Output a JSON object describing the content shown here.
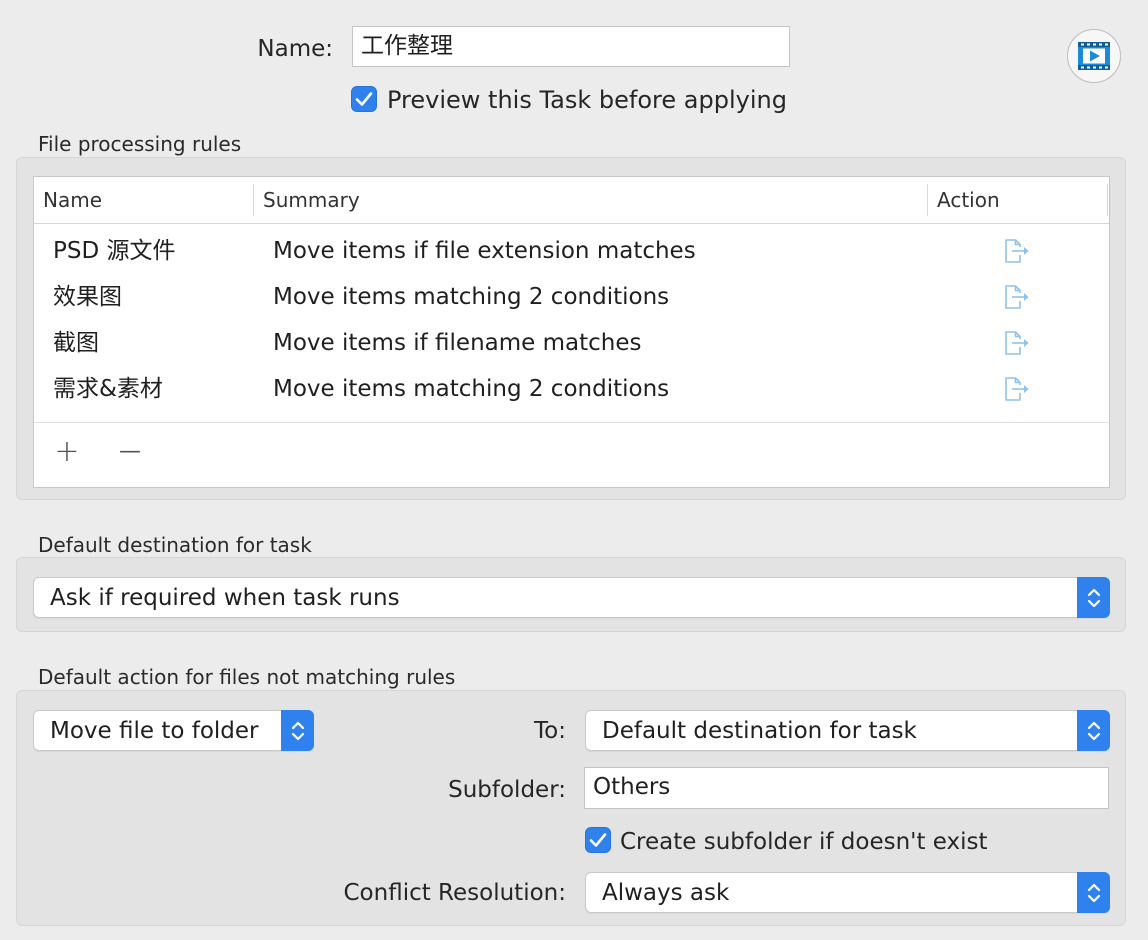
{
  "header": {
    "name_label": "Name:",
    "name_value": "工作整理",
    "preview_checkbox_label": "Preview this Task before applying",
    "preview_checked": true,
    "play_icon": "play-film-icon"
  },
  "rules": {
    "section_title": "File processing rules",
    "columns": [
      "Name",
      "Summary",
      "Action"
    ],
    "rows": [
      {
        "name": "PSD 源文件",
        "summary": "Move items if file extension matches",
        "action_icon": "move-out-icon"
      },
      {
        "name": "效果图",
        "summary": "Move items matching 2 conditions",
        "action_icon": "move-out-icon"
      },
      {
        "name": "截图",
        "summary": "Move items if filename matches",
        "action_icon": "move-out-icon"
      },
      {
        "name": "需求&素材",
        "summary": "Move items matching 2 conditions",
        "action_icon": "move-out-icon"
      }
    ],
    "add_label": "+",
    "remove_label": "—"
  },
  "destination": {
    "section_title": "Default destination for task",
    "selected": "Ask if required when task runs"
  },
  "unmatched": {
    "section_title": "Default action for files not matching rules",
    "action_selected": "Move file to folder",
    "to_label": "To:",
    "to_selected": "Default destination for task",
    "subfolder_label": "Subfolder:",
    "subfolder_value": "Others",
    "create_subfolder_label": "Create subfolder if doesn't exist",
    "create_subfolder_checked": true,
    "conflict_label": "Conflict Resolution:",
    "conflict_selected": "Always ask"
  },
  "colors": {
    "accent": "#2f82ee",
    "action_icon": "#8fc2ea",
    "window_bg": "#ececec"
  }
}
